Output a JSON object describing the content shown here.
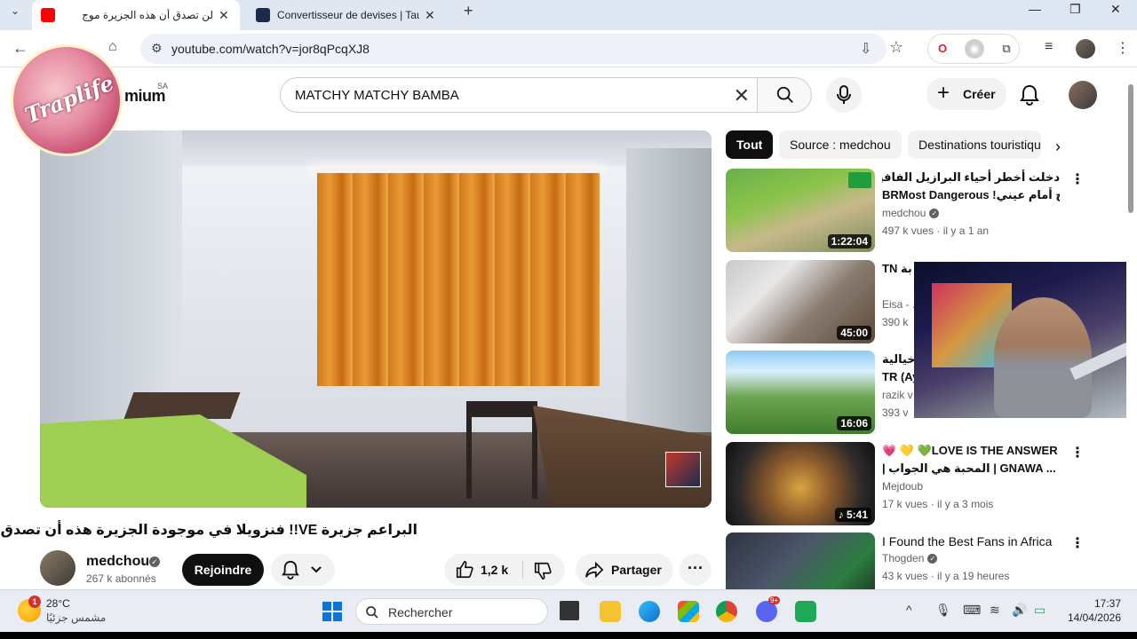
{
  "browser": {
    "tabs": [
      {
        "title": "لن تصدق أن هذه الجزيرة موج",
        "active": true
      },
      {
        "title": "Convertisseur de devises | Taux",
        "active": false
      }
    ],
    "new_tab": "+",
    "url": "youtube.com/watch?v=jor8qPcqXJ8"
  },
  "youtube": {
    "brand": "mium",
    "brand_sup": "SA",
    "logo_badge_text": "Traplife",
    "search_value": "MATCHY MATCHY BAMBA",
    "create_label": "Créer"
  },
  "video": {
    "title": "البراعم جزيرة VE!! فنزويلا في موجودة الجزيرة هذه أن تصدق لن",
    "channel": "medchou",
    "subscribers": "267 k abonnés",
    "join_label": "Rejoindre",
    "likes": "1,2 k",
    "share_label": "Partager"
  },
  "chips": [
    "Tout",
    "Source : medchou",
    "Destinations touristiques"
  ],
  "related": [
    {
      "line1": "دخلت أخطر أحياء البرازيل الفافيلا وشاهدت",
      "line2": "BRMost Dangerous !لاح أمام عيني...",
      "channel": "medchou",
      "verified": true,
      "views": "497 k vues",
      "age": "il y a 1 an",
      "duration": "1:22:04"
    },
    {
      "line1": "TN بة",
      "line2": "",
      "channel": "Eisa - .",
      "verified": false,
      "views": "390 k",
      "age": "",
      "duration": "45:00"
    },
    {
      "line1": "بة خيالية",
      "line2": "TR (Ay",
      "channel": "razik v",
      "verified": false,
      "views": "393 v",
      "age": "",
      "duration": "16:06"
    },
    {
      "line1": "💗 💛 💚LOVE IS THE ANSWER",
      "line2": "| المحبة هي الجواب | GNAWA ...",
      "channel": "Mejdoub",
      "verified": false,
      "views": "17 k vues",
      "age": "il y a 3 mois",
      "duration": "5:41"
    },
    {
      "line1": "I Found the Best Fans in Africa",
      "line2": "",
      "channel": "Thogden",
      "verified": true,
      "views": "43 k vues",
      "age": "il y a 19 heures",
      "duration": ""
    }
  ],
  "taskbar": {
    "weather_badge": "1",
    "temperature": "28°C",
    "weather_desc": "مشمس جزئيًا",
    "search_label": "Rechercher",
    "time": "17:37",
    "date": "14/04/2026",
    "discord_badge": "9+"
  },
  "colors": {
    "youtube_red": "#ff0000",
    "curtain": "#e08a2a",
    "taskbar": "#e9edf3"
  }
}
